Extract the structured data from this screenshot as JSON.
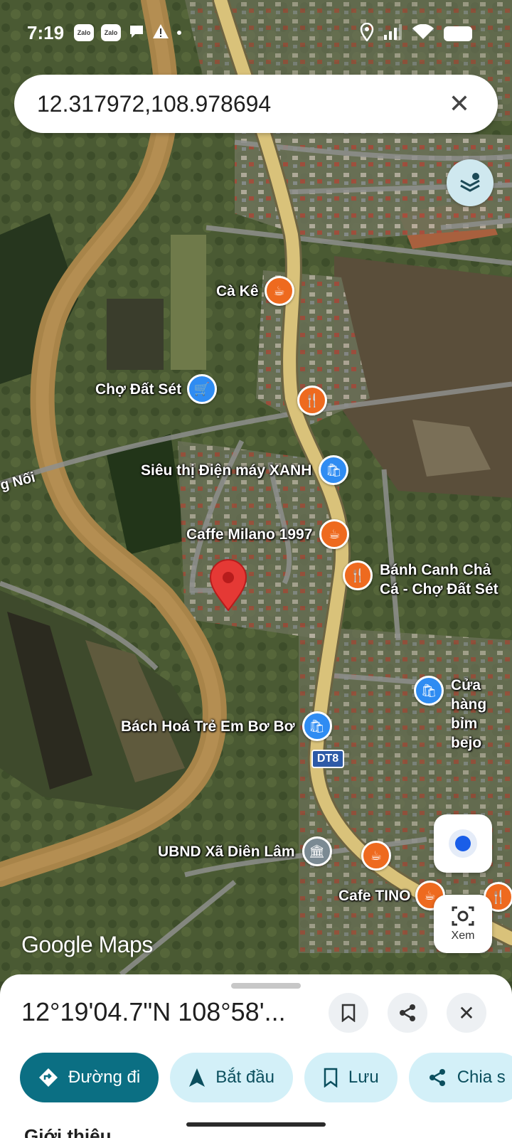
{
  "status_bar": {
    "time": "7:19",
    "notif_app_1": "Zalo",
    "notif_app_2": "Zalo",
    "icons": [
      "zalo-icon",
      "zalo-icon",
      "chat-bubble-icon",
      "warning-icon",
      "dot-icon",
      "location-icon",
      "signal-icon",
      "wifi-icon",
      "battery-icon"
    ]
  },
  "search": {
    "query": "12.317972,108.978694",
    "clear_icon": "close-icon"
  },
  "map": {
    "pois": [
      {
        "name": "Cà Kê",
        "type": "cafe"
      },
      {
        "name": "Chợ Đất Sét",
        "type": "shop"
      },
      {
        "name": "Siêu thị Điện máy XANH",
        "type": "shop"
      },
      {
        "name": "Caffe Milano 1997",
        "type": "cafe"
      },
      {
        "name": "Bánh Canh Chả Cá - Chợ Đất Sét",
        "type": "food"
      },
      {
        "name": "Cửa hàng bỉm bejo",
        "type": "shop"
      },
      {
        "name": "Bách Hoá Trẻ Em Bơ Bơ",
        "type": "shop"
      },
      {
        "name": "UBND Xã Diên Lâm",
        "type": "gov"
      },
      {
        "name": "Cafe TINO",
        "type": "cafe"
      }
    ],
    "road_label": "g Nối",
    "route_shield": "DT8",
    "attribution": "Google Maps",
    "view_button_label": "Xem",
    "colors": {
      "pin": "#e53935",
      "poi_orange": "#ee6a1f",
      "poi_blue": "#2f8cf2",
      "road": "#d9c27a"
    }
  },
  "sheet": {
    "title": "12°19'04.7\"N 108°58'...",
    "actions": [
      {
        "label": "Đường đi",
        "icon": "directions-icon"
      },
      {
        "label": "Bắt đầu",
        "icon": "navigation-arrow-icon"
      },
      {
        "label": "Lưu",
        "icon": "bookmark-icon"
      },
      {
        "label": "Chia s",
        "icon": "share-icon"
      }
    ],
    "section_heading": "Giới thiệu",
    "colors": {
      "primary": "#0b6f83",
      "secondary": "#d3f0f8"
    }
  }
}
